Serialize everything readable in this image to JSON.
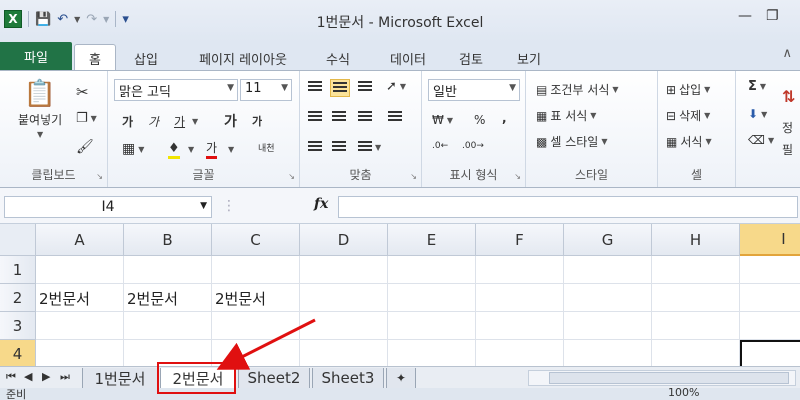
{
  "window": {
    "title": "1번문서 - Microsoft Excel"
  },
  "qat": {
    "app_icon": "X",
    "save": "save-icon",
    "undo": "undo-icon",
    "redo": "redo-icon"
  },
  "tabs": {
    "file": "파일",
    "items": [
      "홈",
      "삽입",
      "페이지 레이아웃",
      "수식",
      "데이터",
      "검토",
      "보기"
    ],
    "active": "홈"
  },
  "ribbon": {
    "clipboard": {
      "label": "클립보드",
      "paste": "붙여넣기"
    },
    "font": {
      "label": "글꼴",
      "name": "맑은 고딕",
      "size": "11",
      "bold": "가",
      "italic": "가",
      "underline": "가",
      "grow": "가",
      "shrink": "가",
      "color": "가",
      "phonetic": "내천"
    },
    "alignment": {
      "label": "맞춤"
    },
    "number": {
      "label": "표시 형식",
      "format": "일반"
    },
    "styles": {
      "label": "스타일",
      "conditional": "조건부 서식",
      "table": "표 서식",
      "cell": "셀 스타일"
    },
    "cells": {
      "label": "셀",
      "insert": "삽입",
      "delete": "삭제",
      "format": "서식"
    },
    "editing": {
      "sum": "Σ",
      "sort": "정",
      "filter": "필"
    }
  },
  "formula_bar": {
    "name_box": "I4",
    "fx": "fx",
    "value": ""
  },
  "grid": {
    "columns": [
      "A",
      "B",
      "C",
      "D",
      "E",
      "F",
      "G",
      "H",
      "I"
    ],
    "rows": [
      "1",
      "2",
      "3",
      "4"
    ],
    "cells": {
      "A2": "2번문서",
      "B2": "2번문서",
      "C2": "2번문서"
    },
    "selected_cell": "I4"
  },
  "sheets": {
    "tabs": [
      "1번문서",
      "2번문서",
      "Sheet2",
      "Sheet3"
    ],
    "active": "2번문서"
  },
  "status": {
    "ready": "준비",
    "zoom": "100%"
  },
  "colors": {
    "accent_green": "#217346",
    "annotation_red": "#e01010",
    "selected_header": "#f7d98a"
  }
}
